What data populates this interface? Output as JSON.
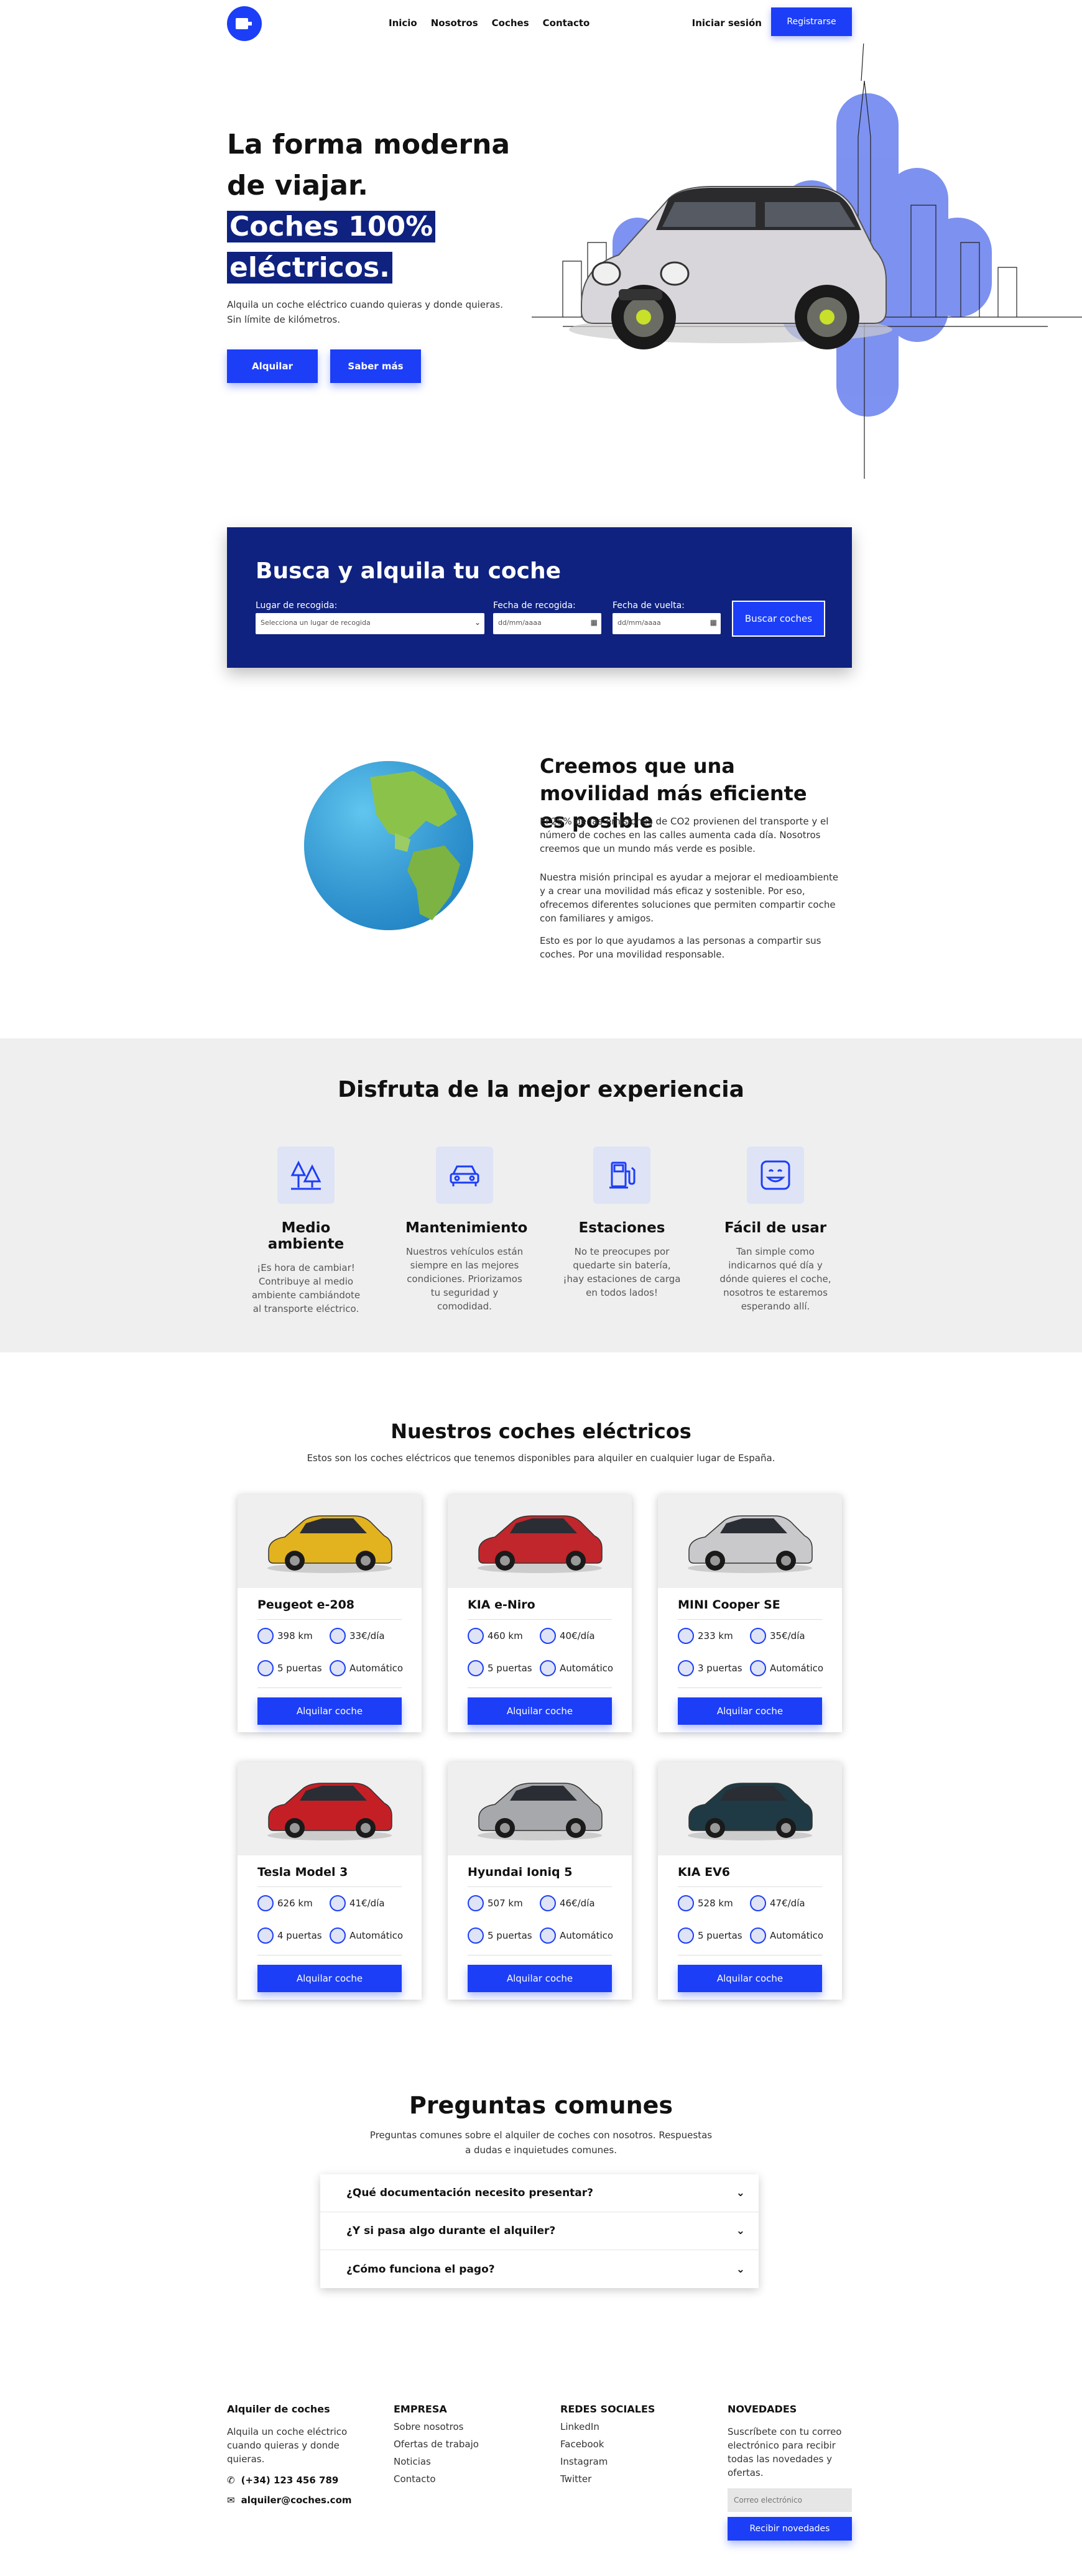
{
  "nav": {
    "links": [
      "Inicio",
      "Nosotros",
      "Coches",
      "Contacto"
    ],
    "login": "Iniciar sesión",
    "register": "Registrarse"
  },
  "hero": {
    "line1": "La forma moderna",
    "line2": "de viajar.",
    "line3": "Coches 100%",
    "line4": "eléctricos.",
    "subtitle": "Alquila un coche eléctrico cuando quieras y donde quieras. Sin límite de kilómetros.",
    "btn_rent": "Alquilar",
    "btn_more": "Saber más"
  },
  "search": {
    "title": "Busca y alquila tu coche",
    "place_label": "Lugar de recogida:",
    "place_value": "Selecciona un lugar de recogida",
    "pickup_label": "Fecha de recogida:",
    "return_label": "Fecha de vuelta:",
    "date_placeholder": "dd/mm/aaaa",
    "button": "Buscar coches"
  },
  "mission": {
    "title": "Creemos que una movilidad más eficiente es posible",
    "p1": "El 25% de las emisiones de CO2 provienen del transporte y el número de coches en las calles aumenta cada día. Nosotros creemos que un mundo más verde es posible.",
    "p2": "Nuestra misión principal es ayudar a mejorar el medioambiente y a crear una movilidad más eficaz y sostenible. Por eso, ofrecemos diferentes soluciones que permiten compartir coche con familiares y amigos.",
    "p3": "Esto es por lo que ayudamos a las personas a compartir sus coches. Por una movilidad responsable."
  },
  "features": {
    "title": "Disfruta de la mejor experiencia",
    "items": [
      {
        "title": "Medio ambiente",
        "text": "¡Es hora de cambiar! Contribuye al medio ambiente cambiándote al transporte eléctrico.",
        "icon": "trees-icon"
      },
      {
        "title": "Mantenimiento",
        "text": "Nuestros vehículos están siempre en las mejores condiciones. Priorizamos tu seguridad y comodidad.",
        "icon": "car-icon"
      },
      {
        "title": "Estaciones",
        "text": "No te preocupes por quedarte sin batería, ¡hay estaciones de carga en todos lados!",
        "icon": "charging-station-icon"
      },
      {
        "title": "Fácil de usar",
        "text": "Tan simple como indicarnos qué día y dónde quieres el coche, nosotros te estaremos esperando allí.",
        "icon": "smiley-icon"
      }
    ]
  },
  "cars": {
    "title": "Nuestros coches eléctricos",
    "subtitle": "Estos son los coches eléctricos que tenemos disponibles para alquiler en cualquier lugar de España.",
    "rent_label": "Alquilar coche",
    "items": [
      {
        "name": "Peugeot e-208",
        "range": "398 km",
        "price": "33€/día",
        "doors": "5 puertas",
        "trans": "Automático",
        "color": "#e2b21f"
      },
      {
        "name": "KIA e-Niro",
        "range": "460 km",
        "price": "40€/día",
        "doors": "5 puertas",
        "trans": "Automático",
        "color": "#c0262b"
      },
      {
        "name": "MINI Cooper SE",
        "range": "233 km",
        "price": "35€/día",
        "doors": "3 puertas",
        "trans": "Automático",
        "color": "#c9c9cc"
      },
      {
        "name": "Tesla Model 3",
        "range": "626 km",
        "price": "41€/día",
        "doors": "4 puertas",
        "trans": "Automático",
        "color": "#c51f26"
      },
      {
        "name": "Hyundai Ioniq 5",
        "range": "507 km",
        "price": "46€/día",
        "doors": "5 puertas",
        "trans": "Automático",
        "color": "#a6a8ab"
      },
      {
        "name": "KIA EV6",
        "range": "528 km",
        "price": "47€/día",
        "doors": "5 puertas",
        "trans": "Automático",
        "color": "#1f3a44"
      }
    ]
  },
  "faq": {
    "title": "Preguntas comunes",
    "subtitle": "Preguntas comunes sobre el alquiler de coches con nosotros. Respuestas a dudas e inquietudes comunes.",
    "items": [
      "¿Qué documentación necesito presentar?",
      "¿Y si pasa algo durante el alquiler?",
      "¿Cómo funciona el pago?"
    ]
  },
  "footer": {
    "brand_title": "Alquiler de coches",
    "brand_text": "Alquila un coche eléctrico cuando quieras y donde quieras.",
    "phone": "(+34) 123 456 789",
    "email": "alquiler@coches.com",
    "company_title": "EMPRESA",
    "company_links": [
      "Sobre nosotros",
      "Ofertas de trabajo",
      "Noticias",
      "Contacto"
    ],
    "social_title": "REDES SOCIALES",
    "social_links": [
      "LinkedIn",
      "Facebook",
      "Instagram",
      "Twitter"
    ],
    "news_title": "NOVEDADES",
    "news_text": "Suscríbete con tu correo electrónico para recibir todas las novedades y ofertas.",
    "email_placeholder": "Correo electrónico",
    "news_button": "Recibir novedades"
  },
  "colors": {
    "accent": "#1c3ef7",
    "navy": "#0f2280",
    "light": "#dfe3f6"
  }
}
